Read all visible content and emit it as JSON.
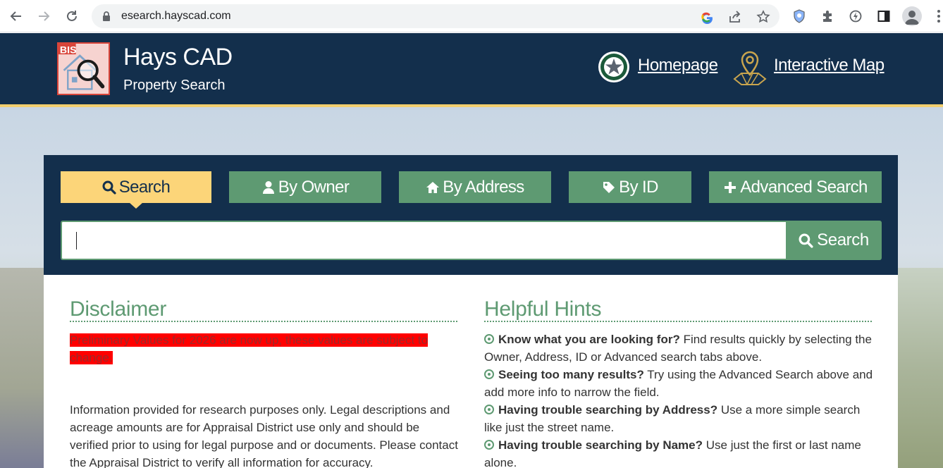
{
  "browser": {
    "url": "esearch.hayscad.com"
  },
  "header": {
    "logo_text": "BIS",
    "title": "Hays CAD",
    "subtitle": "Property Search",
    "links": [
      {
        "label": "Homepage"
      },
      {
        "label": "Interactive Map"
      }
    ]
  },
  "search": {
    "tabs": [
      {
        "label": "Search",
        "icon": "search-icon",
        "active": true
      },
      {
        "label": "By Owner",
        "icon": "user-icon",
        "active": false
      },
      {
        "label": "By Address",
        "icon": "home-icon",
        "active": false
      },
      {
        "label": "By ID",
        "icon": "tag-icon",
        "active": false
      },
      {
        "label": "Advanced Search",
        "icon": "plus-icon",
        "active": false
      }
    ],
    "input_value": "",
    "button_label": "Search"
  },
  "disclaimer": {
    "title": "Disclaimer",
    "alert": "Preliminary Values for 2026 are now up, these values are subject to change.",
    "body": "Information provided for research purposes only. Legal descriptions and acreage amounts are for Appraisal District use only and should be verified prior to using for legal purpose and or documents. Please contact the Appraisal District to verify all information for accuracy."
  },
  "hints": {
    "title": "Helpful Hints",
    "items": [
      {
        "bold": "Know what you are looking for?",
        "text": " Find results quickly by selecting the Owner, Address, ID or Advanced search tabs above."
      },
      {
        "bold": "Seeing too many results?",
        "text": " Try using the Advanced Search above and add more info to narrow the field."
      },
      {
        "bold": "Having trouble searching by Address?",
        "text": " Use a more simple search like just the street name."
      },
      {
        "bold": "Having trouble searching by Name?",
        "text": " Use just the first or last name alone."
      }
    ]
  },
  "colors": {
    "navy": "#132f4c",
    "green": "#5e9a72",
    "gold": "#fcd579",
    "alert_red": "#ff0000"
  }
}
